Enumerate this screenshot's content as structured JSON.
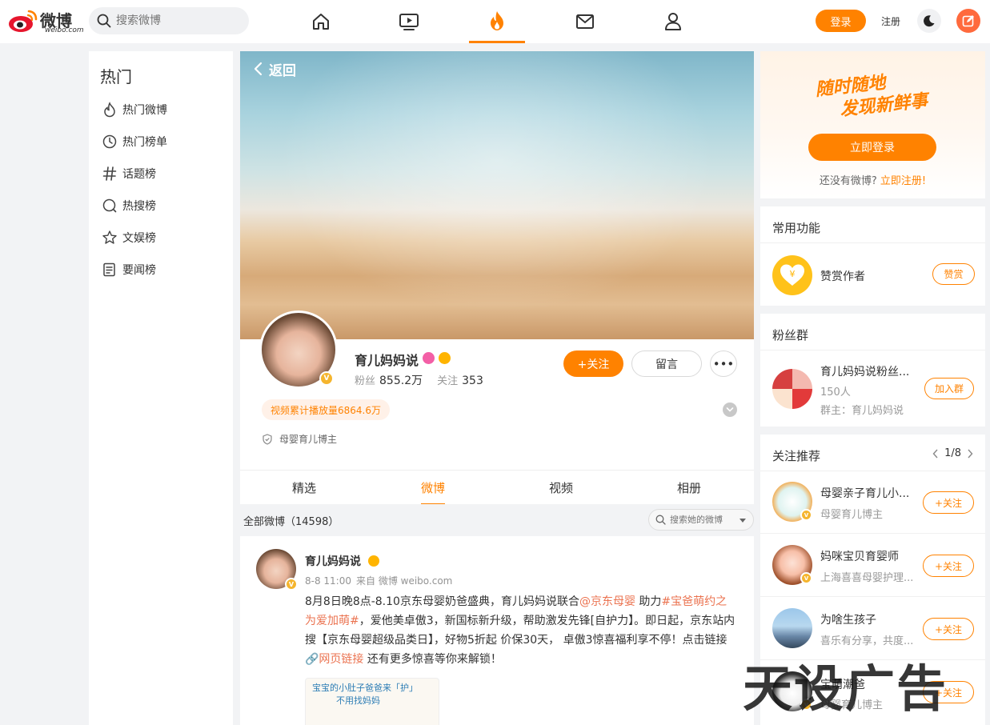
{
  "header": {
    "logo_cn": "微博",
    "logo_en": "weibo.com",
    "search_placeholder": "搜索微博",
    "login": "登录",
    "register": "注册",
    "nav_icons": [
      "home-icon",
      "video-icon",
      "hot-icon",
      "mail-icon",
      "profile-icon"
    ],
    "accent": "#ff8200"
  },
  "left_nav": {
    "title": "热门",
    "items": [
      {
        "label": "热门微博",
        "icon": "flame-icon"
      },
      {
        "label": "热门榜单",
        "icon": "clock-icon"
      },
      {
        "label": "话题榜",
        "icon": "hashtag-icon"
      },
      {
        "label": "热搜榜",
        "icon": "search-rank-icon"
      },
      {
        "label": "文娱榜",
        "icon": "star-icon"
      },
      {
        "label": "要闻榜",
        "icon": "news-icon"
      }
    ]
  },
  "profile": {
    "back": "返回",
    "name": "育儿妈妈说",
    "fans_label": "粉丝",
    "fans_value": "855.2万",
    "follow_label": "关注",
    "follow_value": "353",
    "follow_btn": "+关注",
    "msg_btn": "留言",
    "more_btn": "•••",
    "play_tag": "视频累计播放量6864.6万",
    "desc": "母婴育儿博主",
    "tabs": [
      "精选",
      "微博",
      "视频",
      "相册"
    ],
    "active_tab": "微博"
  },
  "feed": {
    "filter_label": "全部微博（14598）",
    "search_placeholder": "搜索她的微博"
  },
  "post": {
    "name": "育儿妈妈说",
    "time": "8-8 11:00",
    "source": "来自 微博 weibo.com",
    "text_parts": [
      {
        "t": "8月8日晚8点-8.10京东母婴奶爸盛典，育儿妈妈说联合",
        "hl": false
      },
      {
        "t": "@京东母婴",
        "hl": true
      },
      {
        "t": " 助力",
        "hl": false
      },
      {
        "t": "#宝爸萌约之为爱加萌#",
        "hl": true
      },
      {
        "t": "，爱他美卓傲3，新国标新升级，帮助激发先锋[自护力】。即日起，京东站内搜【京东母婴超级品类日】，好物5折起 价保30天， 卓傲3惊喜福利享不停！点击链接",
        "hl": false
      },
      {
        "t": "🔗网页链接",
        "hl": true
      },
      {
        "t": " 还有更多惊喜等你来解锁！",
        "hl": false
      }
    ],
    "image_caption_1": "宝宝的小肚子爸爸来「护」",
    "image_caption_2": "不用找妈妈"
  },
  "right": {
    "promo_line1": "随时随地",
    "promo_line2": "发现新鲜事",
    "promo_btn": "立即登录",
    "promo_tip": "还没有微博?",
    "promo_link": "立即注册!",
    "common_title": "常用功能",
    "reward_label": "赞赏作者",
    "reward_btn": "赞赏",
    "fans_title": "粉丝群",
    "group_name": "育儿妈妈说粉丝...",
    "group_count": "150人",
    "group_owner": "群主：育儿妈妈说",
    "group_btn": "加入群",
    "rec_title": "关注推荐",
    "rec_page": "1/8",
    "rec_btn": "+关注",
    "recs": [
      {
        "name": "母婴亲子育儿小...",
        "sub": "母婴育儿博主"
      },
      {
        "name": "妈咪宝贝育婴师",
        "sub": "上海喜喜母婴护理..."
      },
      {
        "name": "为啥生孩子",
        "sub": "喜乐有分享，共度..."
      },
      {
        "name": "宝萌潮爸",
        "sub": "母婴育儿博主"
      }
    ]
  },
  "watermark": "天设广告"
}
